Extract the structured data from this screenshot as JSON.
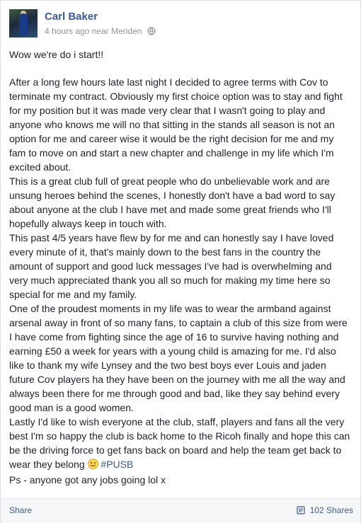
{
  "post": {
    "author": "Carl Baker",
    "time": "4 hours ago near Meriden",
    "opening": "Wow we're do i start!!",
    "paragraphs": [
      "After a long few hours late last night I decided to agree terms with Cov to terminate my contract. Obviously my first choice option was to stay and fight for my position but it was made very clear that I wasn't going to play and anyone who knows me will no that sitting in the stands all season is not an option for me and career wise it would be the right decision for me and my fam to move on and start a new chapter and challenge in my life which I'm excited about.",
      "This is a great club full of great people who do unbelievable work and are unsung heroes behind the scenes, I honestly don't have a bad word to say about anyone at the club I have met and made some great friends who I'll hopefully always keep in touch with.",
      "This past 4/5 years have flew by for me and can honestly say I have loved every minute of it, that's mainly down to the best fans in the country the amount of support and good luck messages I've had is overwhelming and very much appreciated thank you all so much for making my time here so special for me and my family.",
      "One of the proudest moments in my life was to wear the armband against arsenal away in front of so many fans, to captain a club of this size from were I have come from fighting since the age of 16 to survive having nothing and earning £50 a week for years with a young child is amazing for me. I'd also like to thank my wife Lynsey and the two best boys ever Louis and jaden future Cov players ha they have been on the journey with me all the way and always been there for me through good and bad, like they say behind every good man is a good women."
    ],
    "closing": "Lastly I'd like to wish everyone at the club, staff, players and fans all the very best I'm so happy the club is back home to the Ricoh finally and hope this can be the driving force to get fans back on board and help the team get back to wear they belong",
    "hashtag": "#PUSB",
    "ps": "Ps - anyone got any jobs going lol x"
  },
  "footer": {
    "share_label": "Share",
    "shares_count": "102 Shares"
  },
  "icons": {
    "globe": "globe-icon",
    "smiley": "smiley-emoji-icon",
    "shares": "shares-icon"
  },
  "colors": {
    "link": "#3b5998",
    "text": "#1d2129",
    "meta": "#90949c"
  }
}
